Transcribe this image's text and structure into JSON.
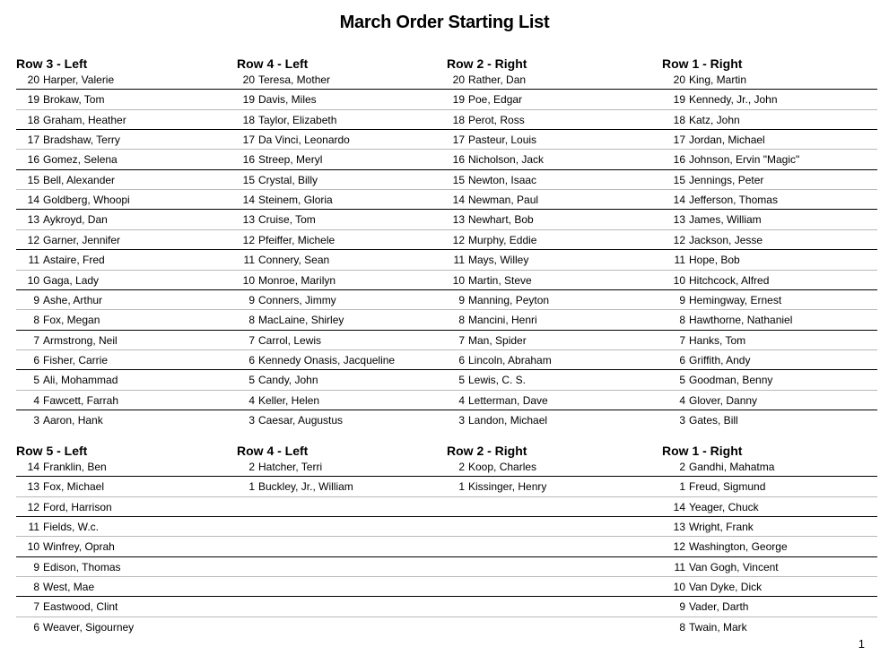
{
  "title": "March Order Starting List",
  "page_number": "1",
  "sections": [
    {
      "columns": [
        {
          "heading": "Row 3 - Left",
          "entries": [
            {
              "num": "20",
              "name": "Harper, Valerie"
            },
            {
              "num": "19",
              "name": "Brokaw, Tom"
            },
            {
              "num": "18",
              "name": "Graham, Heather"
            },
            {
              "num": "17",
              "name": "Bradshaw, Terry"
            },
            {
              "num": "16",
              "name": "Gomez, Selena"
            },
            {
              "num": "15",
              "name": "Bell, Alexander"
            },
            {
              "num": "14",
              "name": "Goldberg, Whoopi"
            },
            {
              "num": "13",
              "name": "Aykroyd, Dan"
            },
            {
              "num": "12",
              "name": "Garner, Jennifer"
            },
            {
              "num": "11",
              "name": "Astaire, Fred"
            },
            {
              "num": "10",
              "name": "Gaga, Lady"
            },
            {
              "num": "9",
              "name": "Ashe, Arthur"
            },
            {
              "num": "8",
              "name": "Fox, Megan"
            },
            {
              "num": "7",
              "name": "Armstrong, Neil"
            },
            {
              "num": "6",
              "name": "Fisher, Carrie"
            },
            {
              "num": "5",
              "name": "Ali, Mohammad"
            },
            {
              "num": "4",
              "name": "Fawcett, Farrah"
            },
            {
              "num": "3",
              "name": "Aaron, Hank"
            }
          ]
        },
        {
          "heading": "Row 4 - Left",
          "entries": [
            {
              "num": "20",
              "name": "Teresa, Mother"
            },
            {
              "num": "19",
              "name": "Davis, Miles"
            },
            {
              "num": "18",
              "name": "Taylor, Elizabeth"
            },
            {
              "num": "17",
              "name": "Da Vinci, Leonardo"
            },
            {
              "num": "16",
              "name": "Streep, Meryl"
            },
            {
              "num": "15",
              "name": "Crystal, Billy"
            },
            {
              "num": "14",
              "name": "Steinem, Gloria"
            },
            {
              "num": "13",
              "name": "Cruise, Tom"
            },
            {
              "num": "12",
              "name": "Pfeiffer, Michele"
            },
            {
              "num": "11",
              "name": "Connery, Sean"
            },
            {
              "num": "10",
              "name": "Monroe, Marilyn"
            },
            {
              "num": "9",
              "name": "Conners, Jimmy"
            },
            {
              "num": "8",
              "name": "MacLaine, Shirley"
            },
            {
              "num": "7",
              "name": "Carrol, Lewis"
            },
            {
              "num": "6",
              "name": "Kennedy Onasis, Jacqueline"
            },
            {
              "num": "5",
              "name": "Candy, John"
            },
            {
              "num": "4",
              "name": "Keller, Helen"
            },
            {
              "num": "3",
              "name": "Caesar, Augustus"
            }
          ]
        },
        {
          "heading": "Row 2 - Right",
          "entries": [
            {
              "num": "20",
              "name": "Rather, Dan"
            },
            {
              "num": "19",
              "name": "Poe, Edgar"
            },
            {
              "num": "18",
              "name": "Perot, Ross"
            },
            {
              "num": "17",
              "name": "Pasteur, Louis"
            },
            {
              "num": "16",
              "name": "Nicholson, Jack"
            },
            {
              "num": "15",
              "name": "Newton, Isaac"
            },
            {
              "num": "14",
              "name": "Newman, Paul"
            },
            {
              "num": "13",
              "name": "Newhart, Bob"
            },
            {
              "num": "12",
              "name": "Murphy, Eddie"
            },
            {
              "num": "11",
              "name": "Mays, Willey"
            },
            {
              "num": "10",
              "name": "Martin, Steve"
            },
            {
              "num": "9",
              "name": "Manning, Peyton"
            },
            {
              "num": "8",
              "name": "Mancini, Henri"
            },
            {
              "num": "7",
              "name": "Man, Spider"
            },
            {
              "num": "6",
              "name": "Lincoln, Abraham"
            },
            {
              "num": "5",
              "name": "Lewis, C. S."
            },
            {
              "num": "4",
              "name": "Letterman, Dave"
            },
            {
              "num": "3",
              "name": "Landon, Michael"
            }
          ]
        },
        {
          "heading": "Row 1 - Right",
          "entries": [
            {
              "num": "20",
              "name": "King, Martin"
            },
            {
              "num": "19",
              "name": "Kennedy, Jr., John"
            },
            {
              "num": "18",
              "name": "Katz, John"
            },
            {
              "num": "17",
              "name": "Jordan, Michael"
            },
            {
              "num": "16",
              "name": "Johnson, Ervin \"Magic\""
            },
            {
              "num": "15",
              "name": "Jennings, Peter"
            },
            {
              "num": "14",
              "name": "Jefferson, Thomas"
            },
            {
              "num": "13",
              "name": "James, William"
            },
            {
              "num": "12",
              "name": "Jackson, Jesse"
            },
            {
              "num": "11",
              "name": "Hope, Bob"
            },
            {
              "num": "10",
              "name": "Hitchcock, Alfred"
            },
            {
              "num": "9",
              "name": "Hemingway, Ernest"
            },
            {
              "num": "8",
              "name": "Hawthorne, Nathaniel"
            },
            {
              "num": "7",
              "name": "Hanks, Tom"
            },
            {
              "num": "6",
              "name": "Griffith, Andy"
            },
            {
              "num": "5",
              "name": "Goodman, Benny"
            },
            {
              "num": "4",
              "name": "Glover, Danny"
            },
            {
              "num": "3",
              "name": "Gates, Bill"
            }
          ]
        }
      ]
    },
    {
      "columns": [
        {
          "heading": "Row 5 - Left",
          "entries": [
            {
              "num": "14",
              "name": "Franklin, Ben"
            },
            {
              "num": "13",
              "name": "Fox, Michael"
            },
            {
              "num": "12",
              "name": "Ford, Harrison"
            },
            {
              "num": "11",
              "name": "Fields, W.c."
            },
            {
              "num": "10",
              "name": "Winfrey, Oprah"
            },
            {
              "num": "9",
              "name": "Edison, Thomas"
            },
            {
              "num": "8",
              "name": "West, Mae"
            },
            {
              "num": "7",
              "name": "Eastwood, Clint"
            },
            {
              "num": "6",
              "name": "Weaver, Sigourney"
            }
          ]
        },
        {
          "heading": "Row 4 - Left",
          "entries": [
            {
              "num": "2",
              "name": "Hatcher, Terri"
            },
            {
              "num": "1",
              "name": "Buckley, Jr., William"
            }
          ]
        },
        {
          "heading": "Row 2 - Right",
          "entries": [
            {
              "num": "2",
              "name": "Koop, Charles"
            },
            {
              "num": "1",
              "name": "Kissinger, Henry"
            }
          ]
        },
        {
          "heading": "Row 1 - Right",
          "entries": [
            {
              "num": "2",
              "name": "Gandhi, Mahatma"
            },
            {
              "num": "1",
              "name": "Freud, Sigmund"
            },
            {
              "num": "14",
              "name": "Yeager, Chuck"
            },
            {
              "num": "13",
              "name": "Wright, Frank"
            },
            {
              "num": "12",
              "name": "Washington, George"
            },
            {
              "num": "11",
              "name": "Van Gogh, Vincent"
            },
            {
              "num": "10",
              "name": "Van Dyke, Dick"
            },
            {
              "num": "9",
              "name": "Vader, Darth"
            },
            {
              "num": "8",
              "name": "Twain, Mark"
            }
          ]
        }
      ]
    }
  ]
}
